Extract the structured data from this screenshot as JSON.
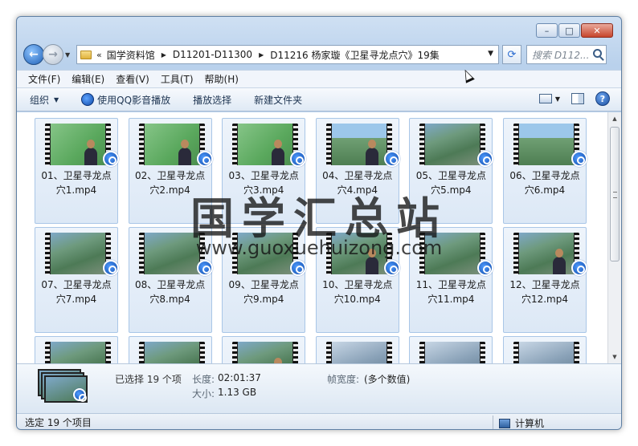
{
  "window": {
    "btn_min": "–",
    "btn_max": "□",
    "btn_close": "✕"
  },
  "nav": {
    "back_glyph": "←",
    "fwd_glyph": "→",
    "chev": "«",
    "breadcrumbs": [
      "国学资料馆",
      "D11201-D11300",
      "D11216 杨家璇《卫星寻龙点穴》19集"
    ],
    "refresh_glyph": "⟳",
    "search_placeholder": "搜索 D112..."
  },
  "menu": [
    "文件(F)",
    "编辑(E)",
    "查看(V)",
    "工具(T)",
    "帮助(H)"
  ],
  "toolbar": {
    "organize": "组织",
    "play_qq": "使用QQ影音播放",
    "play_selected": "播放选择",
    "new_folder": "新建文件夹",
    "help_glyph": "?"
  },
  "files": [
    {
      "label": "01、卫星寻龙点穴1.mp4",
      "frame": "green",
      "person": true
    },
    {
      "label": "02、卫星寻龙点穴2.mp4",
      "frame": "green",
      "person": true
    },
    {
      "label": "03、卫星寻龙点穴3.mp4",
      "frame": "green",
      "person": true
    },
    {
      "label": "04、卫星寻龙点穴4.mp4",
      "frame": "sky",
      "person": true
    },
    {
      "label": "05、卫星寻龙点穴5.mp4",
      "frame": "sat",
      "person": false
    },
    {
      "label": "06、卫星寻龙点穴6.mp4",
      "frame": "sky",
      "person": false
    },
    {
      "label": "07、卫星寻龙点穴7.mp4",
      "frame": "sat",
      "person": false
    },
    {
      "label": "08、卫星寻龙点穴8.mp4",
      "frame": "sat",
      "person": false
    },
    {
      "label": "09、卫星寻龙点穴9.mp4",
      "frame": "sat",
      "person": false
    },
    {
      "label": "10、卫星寻龙点穴10.mp4",
      "frame": "sat",
      "person": true
    },
    {
      "label": "11、卫星寻龙点穴11.mp4",
      "frame": "sat",
      "person": false
    },
    {
      "label": "12、卫星寻龙点穴12.mp4",
      "frame": "sat",
      "person": true
    },
    {
      "label": "",
      "frame": "sat",
      "person": false
    },
    {
      "label": "",
      "frame": "sat",
      "person": false
    },
    {
      "label": "",
      "frame": "sat",
      "person": true
    },
    {
      "label": "",
      "frame": "snow",
      "person": false
    },
    {
      "label": "",
      "frame": "snow",
      "person": false
    },
    {
      "label": "",
      "frame": "snow",
      "person": false
    }
  ],
  "details": {
    "selected": "已选择 19 个项",
    "length_label": "长度:",
    "length_value": "02:01:37",
    "size_label": "大小:",
    "size_value": "1.13 GB",
    "frame_width_label": "帧宽度:",
    "frame_width_value": "(多个数值)"
  },
  "status": {
    "selected": "选定 19 个项目",
    "computer": "计算机"
  },
  "watermark": {
    "title": "国学汇总站",
    "url": "www.guoxuehuizong.com"
  }
}
